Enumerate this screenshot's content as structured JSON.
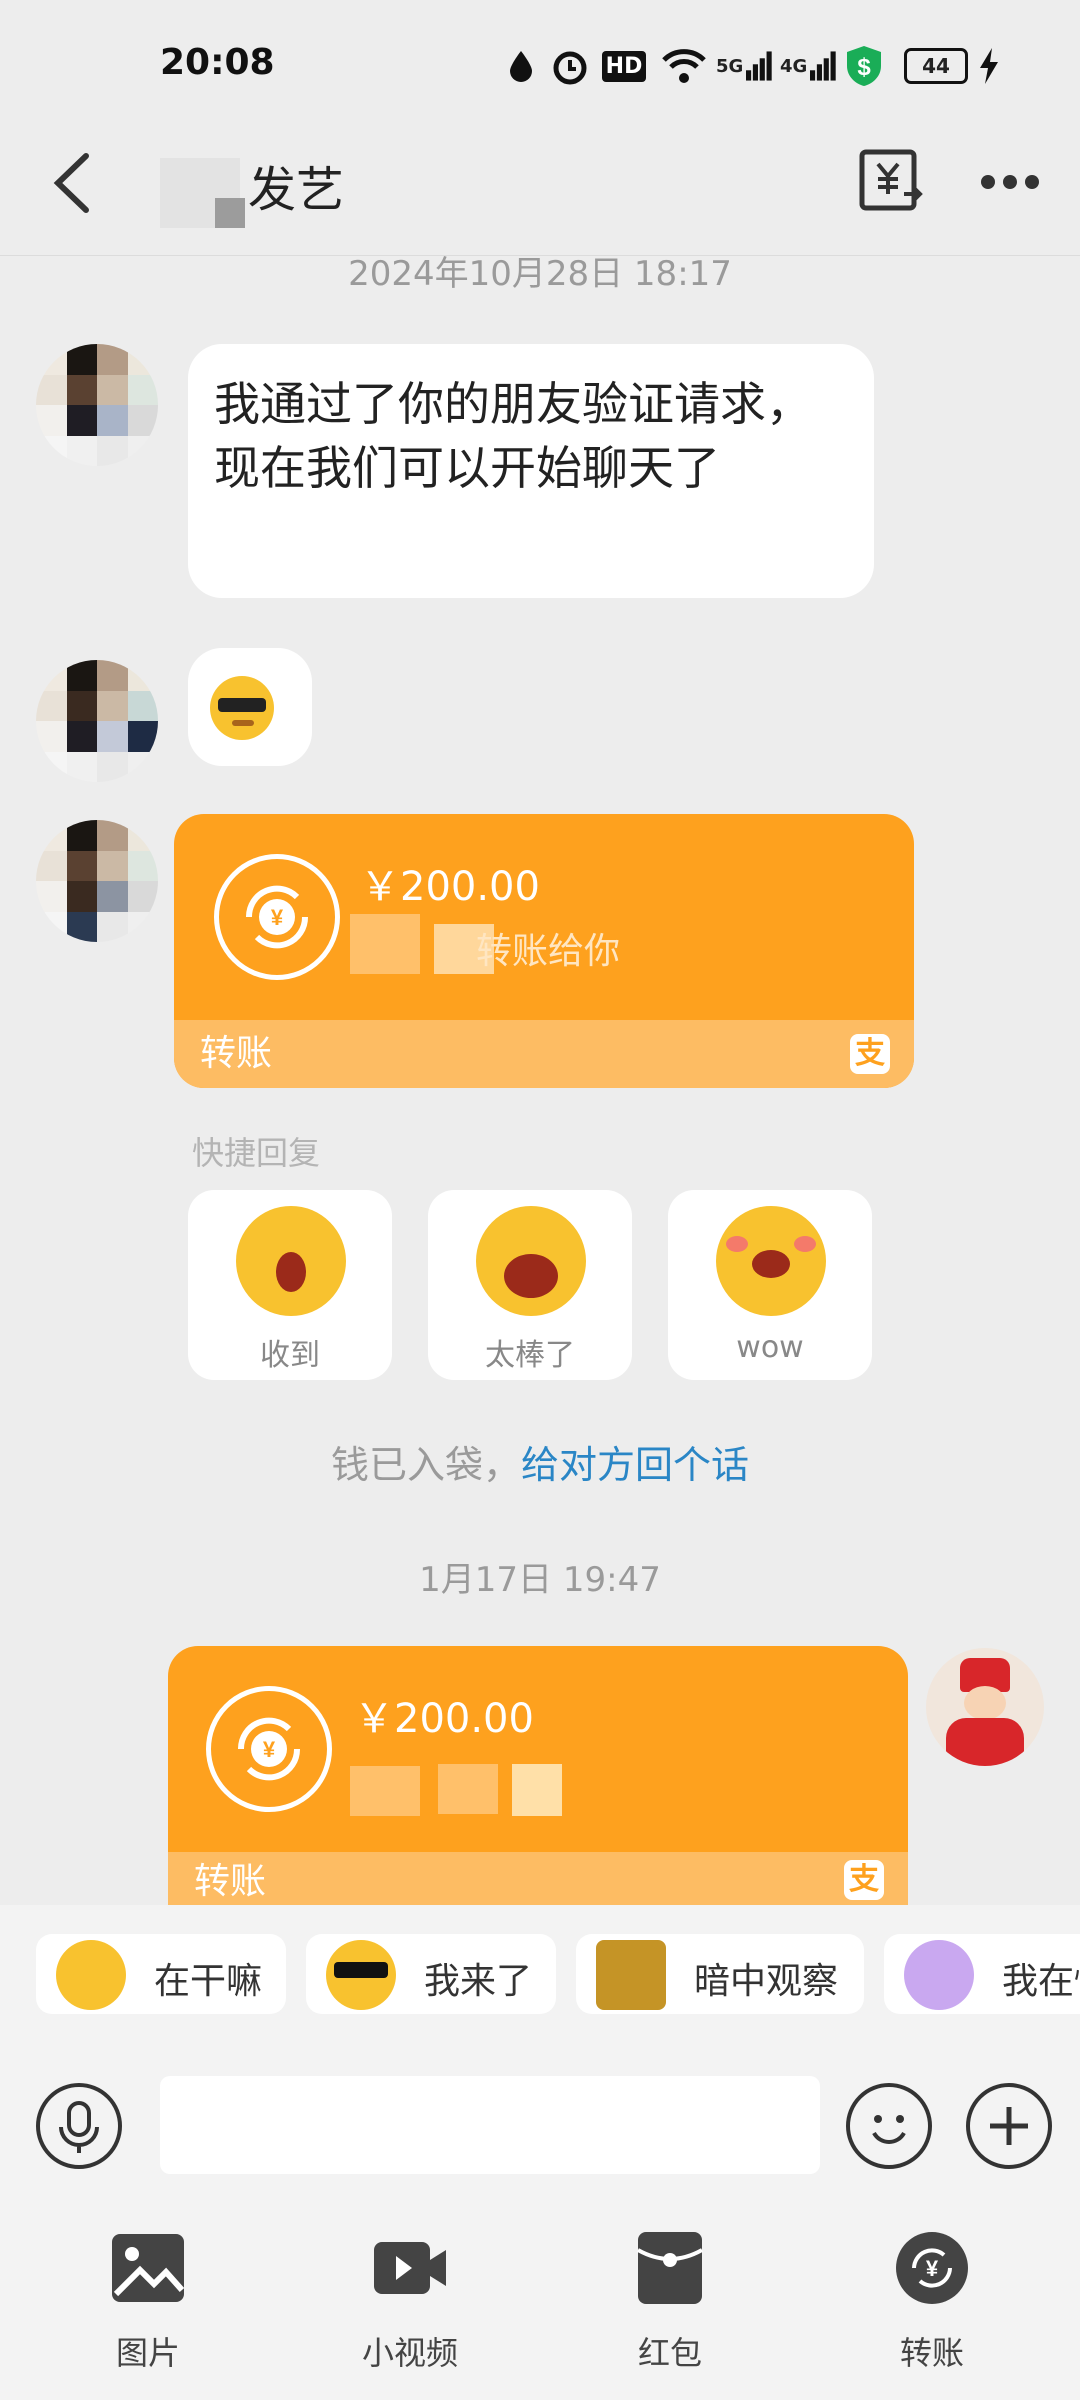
{
  "status_bar": {
    "time": "20:08",
    "icons": [
      "water-drop-icon",
      "alarm-icon",
      "hd-icon",
      "wifi-icon",
      "5g-signal-icon",
      "4g-signal-icon",
      "shield-icon",
      "battery-icon",
      "charging-icon"
    ],
    "hd": "HD",
    "n5g": "5G",
    "n4g": "4G",
    "battery": "44"
  },
  "header": {
    "title_visible": "发艺",
    "icons": [
      "back-icon",
      "bill-icon",
      "more-icon"
    ]
  },
  "chat": {
    "ts1": "2024年10月28日   18:17",
    "msg1": "我通过了你的朋友验证请求，现在我们可以开始聊天了",
    "transfer1": {
      "amount": "￥200.00",
      "desc": "转账给你",
      "label": "转账"
    },
    "quick_reply_title": "快捷回复",
    "quick_replies": [
      "收到",
      "太棒了",
      "wow"
    ],
    "note_prefix": "钱已入袋，",
    "note_link": "给对方回个话",
    "ts2": "1月17日   19:47",
    "transfer2": {
      "amount": "￥200.00",
      "label": "转账"
    }
  },
  "stickers": [
    "在干嘛",
    "我来了",
    "暗中观察",
    "我在忙"
  ],
  "tabs": [
    {
      "label": "图片",
      "icon": "image-icon"
    },
    {
      "label": "小视频",
      "icon": "video-icon"
    },
    {
      "label": "红包",
      "icon": "red-envelope-icon"
    },
    {
      "label": "转账",
      "icon": "transfer-icon"
    }
  ],
  "colors": {
    "accent": "#fea11e",
    "accent_light": "#fdbc63",
    "link": "#2a86c6"
  }
}
